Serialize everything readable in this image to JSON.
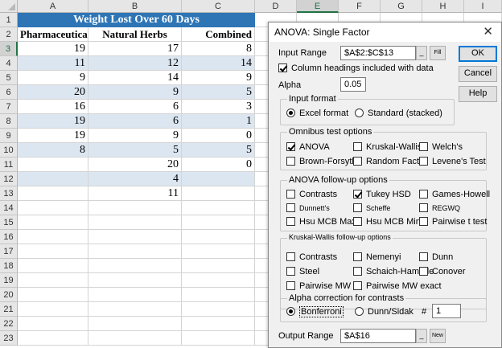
{
  "sheet": {
    "columns": [
      "A",
      "B",
      "C",
      "D",
      "E",
      "F",
      "G",
      "H",
      "I"
    ],
    "active_column": "E",
    "rows": [
      "1",
      "2",
      "3",
      "4",
      "5",
      "6",
      "7",
      "8",
      "9",
      "10",
      "11",
      "12",
      "13",
      "14",
      "15",
      "16",
      "17",
      "18",
      "19",
      "20",
      "21",
      "22",
      "23"
    ],
    "active_row": "3",
    "title": "Weight Lost Over 60 Days",
    "headers": [
      "Pharmaceutical",
      "Natural Herbs",
      "Combined"
    ],
    "data": [
      [
        "19",
        "17",
        "8"
      ],
      [
        "11",
        "12",
        "14"
      ],
      [
        "9",
        "14",
        "9"
      ],
      [
        "20",
        "9",
        "5"
      ],
      [
        "16",
        "6",
        "3"
      ],
      [
        "19",
        "6",
        "1"
      ],
      [
        "19",
        "9",
        "0"
      ],
      [
        "8",
        "5",
        "5"
      ],
      [
        "",
        "20",
        "0"
      ],
      [
        "",
        "4",
        ""
      ],
      [
        "",
        "11",
        ""
      ]
    ],
    "colors": {
      "title_bg": "#2e75b6",
      "band_bg": "#dce6f1",
      "accent": "#217346"
    }
  },
  "dialog": {
    "title": "ANOVA: Single Factor",
    "close_icon": "close-icon",
    "input_range_label": "Input Range",
    "input_range_value": "$A$2:$C$13",
    "fill_label": "Fill",
    "col_headings_label": "Column headings included with data",
    "alpha_label": "Alpha",
    "alpha_value": "0.05",
    "ok_label": "OK",
    "cancel_label": "Cancel",
    "help_label": "Help",
    "input_format": {
      "title": "Input format",
      "excel": "Excel format",
      "standard": "Standard (stacked)"
    },
    "omnibus": {
      "title": "Omnibus test options",
      "anova": "ANOVA",
      "kruskal": "Kruskal-Wallis",
      "welch": "Welch's",
      "brown": "Brown-Forsythe",
      "random": "Random Factor",
      "levene": "Levene's Test"
    },
    "followup": {
      "title": "ANOVA follow-up options",
      "contrasts": "Contrasts",
      "tukey": "Tukey HSD",
      "games": "Games-Howell",
      "dunnett": "Dunnett's",
      "scheffe": "Scheffe",
      "regwq": "REGWQ",
      "hsu_max": "Hsu MCB Max",
      "hsu_min": "Hsu MCB Min",
      "pairwise_t": "Pairwise t test"
    },
    "kw": {
      "title": "Kruskal-Wallis follow-up options",
      "contrasts": "Contrasts",
      "nemenyi": "Nemenyi",
      "dunn": "Dunn",
      "steel": "Steel",
      "schaich": "Schaich-Hamerle",
      "conover": "Conover",
      "pairwise_mw": "Pairwise MW",
      "pairwise_mw_exact": "Pairwise MW exact"
    },
    "alpha_corr": {
      "title": "Alpha correction for contrasts",
      "bonferroni": "Bonferroni",
      "dunn_sidak": "Dunn/Sidak",
      "hash": "#",
      "count": "1"
    },
    "output_range_label": "Output Range",
    "output_range_value": "$A$16",
    "new_label": "New"
  }
}
